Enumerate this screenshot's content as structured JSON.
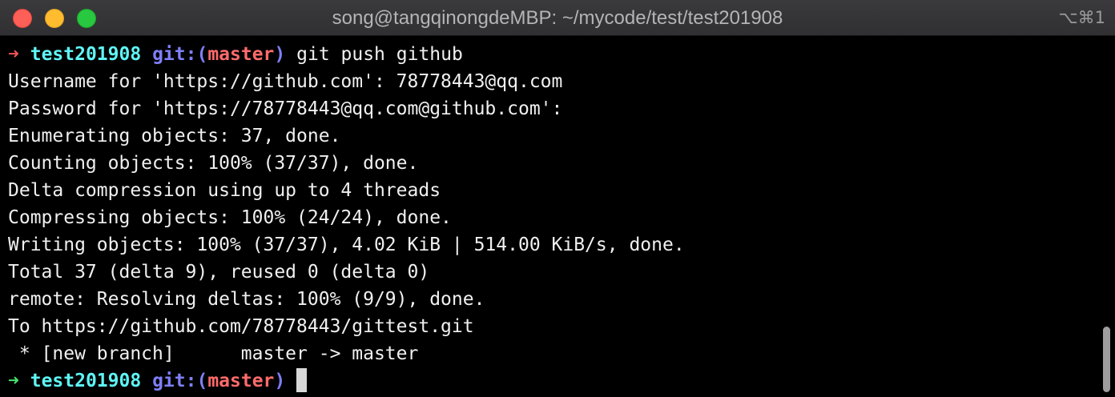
{
  "window": {
    "title": "song@tangqinongdeMBP: ~/mycode/test/test201908",
    "shortcut": "⌥⌘1"
  },
  "colors": {
    "prompt_arrow_error": "#f25454",
    "prompt_arrow_ok": "#47e36b",
    "directory": "#5ff5f5",
    "git_label": "#7f7ff8",
    "branch": "#ff6b6b",
    "output_text": "#f0f0f0"
  },
  "prompt1": {
    "arrow": "➜",
    "directory": "test201908",
    "git_prefix": "git:(",
    "branch": "master",
    "git_suffix": ")",
    "command": "git push github"
  },
  "output_lines": [
    "Username for 'https://github.com': 78778443@qq.com",
    "Password for 'https://78778443@qq.com@github.com':",
    "Enumerating objects: 37, done.",
    "Counting objects: 100% (37/37), done.",
    "Delta compression using up to 4 threads",
    "Compressing objects: 100% (24/24), done.",
    "Writing objects: 100% (37/37), 4.02 KiB | 514.00 KiB/s, done.",
    "Total 37 (delta 9), reused 0 (delta 0)",
    "remote: Resolving deltas: 100% (9/9), done.",
    "To https://github.com/78778443/gittest.git",
    " * [new branch]      master -> master"
  ],
  "prompt2": {
    "arrow": "➜",
    "directory": "test201908",
    "git_prefix": "git:(",
    "branch": "master",
    "git_suffix": ")"
  }
}
